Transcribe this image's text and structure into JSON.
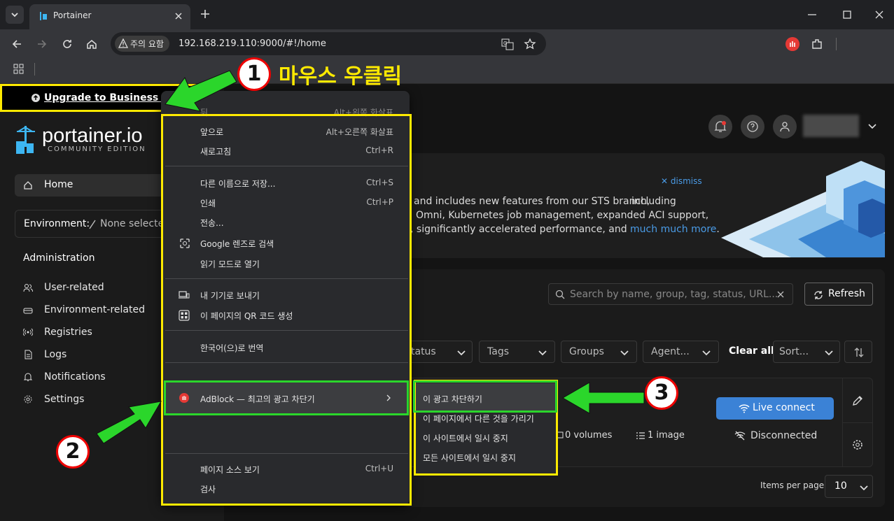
{
  "browser": {
    "tab_title": "Portainer",
    "security_chip": "주의 요함",
    "url": "192.168.219.110:9000/#!/home"
  },
  "annotations": {
    "step1_label": "마우스 우클릭",
    "marker1": "1",
    "marker2": "2",
    "marker3": "3"
  },
  "sidebar": {
    "upgrade_label": "Upgrade to Business Editi",
    "logo_text": "portainer.io",
    "logo_subtitle": "COMMUNITY EDITION",
    "home_label": "Home",
    "environment_label": "Environment:",
    "environment_value": "None selecte",
    "admin_heading": "Administration",
    "items": [
      {
        "label": "User-related",
        "icon": "users-icon"
      },
      {
        "label": "Environment-related",
        "icon": "drive-icon"
      },
      {
        "label": "Registries",
        "icon": "radio-icon"
      },
      {
        "label": "Logs",
        "icon": "file-icon"
      },
      {
        "label": "Notifications",
        "icon": "bell-icon"
      },
      {
        "label": "Settings",
        "icon": "gear-icon"
      }
    ]
  },
  "context_menu": {
    "back_partial_label": "뒤",
    "back_partial_shortcut": "Alt+왼쪽 화살표",
    "items": [
      {
        "label": "앞으로",
        "shortcut": "Alt+오른쪽 화살표"
      },
      {
        "label": "새로고침",
        "shortcut": "Ctrl+R"
      },
      {
        "label": "다른 이름으로 저장...",
        "shortcut": "Ctrl+S"
      },
      {
        "label": "인쇄",
        "shortcut": "Ctrl+P"
      },
      {
        "label": "전송...",
        "shortcut": ""
      },
      {
        "label": "Google 렌즈로 검색",
        "shortcut": ""
      },
      {
        "label": "읽기 모드로 열기",
        "shortcut": ""
      },
      {
        "label": "내 기기로 보내기",
        "shortcut": ""
      },
      {
        "label": "이 페이지의 QR 코드 생성",
        "shortcut": ""
      },
      {
        "label": "한국어(으)로 번역",
        "shortcut": ""
      },
      {
        "label": "AdBlock — 최고의 광고 차단기",
        "shortcut": ""
      },
      {
        "label": "페이지 소스 보기",
        "shortcut": "Ctrl+U"
      },
      {
        "label": "검사",
        "shortcut": ""
      }
    ]
  },
  "submenu": {
    "items": [
      "이 광고 차단하기",
      "이 페이지에서 다른 것을 가리기",
      "이 사이트에서 일시 중지",
      "모든 사이트에서 일시 중지"
    ]
  },
  "main": {
    "dismiss_label": "dismiss",
    "banner_line1": "including",
    "banner_line2": "and includes new features from our STS branch,",
    "banner_line3": "Omni, Kubernetes job management, expanded ACI support,",
    "banner_line4_prefix": ", significantly accelerated performance, and",
    "banner_link": "much much more",
    "banner_line4_suffix": ".",
    "search_placeholder": "Search by name, group, tag, status, URL...",
    "refresh_label": "Refresh",
    "filters": {
      "status": "tatus",
      "tags": "Tags",
      "groups": "Groups",
      "agent": "Agent...",
      "clear_all": "Clear all",
      "sort": "Sort..."
    },
    "env_card": {
      "live_connect": "Live connect",
      "volumes": "0 volumes",
      "images": "1 image",
      "status": "Disconnected"
    },
    "items_per_page_label": "Items per page",
    "items_per_page_value": "10"
  },
  "colors": {
    "annotation_yellow": "#ffea00",
    "annotation_green": "#2bd62b",
    "link_blue": "#4a9be6",
    "live_connect_bg": "#3b82d6"
  }
}
